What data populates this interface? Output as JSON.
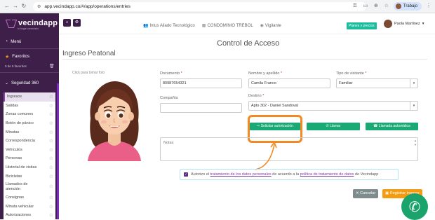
{
  "browser": {
    "url": "app.vecindapp.co/#/app/operations/entries",
    "profile": "Trabajo"
  },
  "sidebar": {
    "logo": "vecindapp",
    "logo_tagline": "tu hogar conectado",
    "menu_label": "Menú",
    "favorites_label": "Favoritos",
    "favorites_count": "0 de 5 favoritos",
    "section": "Seguridad 360",
    "items": [
      {
        "label": "Ingresos"
      },
      {
        "label": "Salidas"
      },
      {
        "label": "Zonas comunes"
      },
      {
        "label": "Botón de pánico"
      },
      {
        "label": "Minutas"
      },
      {
        "label": "Correspondencia"
      },
      {
        "label": "Vehículos"
      },
      {
        "label": "Personas"
      },
      {
        "label": "Historial de visitas"
      },
      {
        "label": "Bicicletas"
      },
      {
        "label": "Llamados de atención"
      },
      {
        "label": "Consignas"
      },
      {
        "label": "Minuta vehicular"
      },
      {
        "label": "Autorizaciones"
      }
    ]
  },
  "topbar": {
    "nav": [
      {
        "label": "Intus Aliado Tecnológico"
      },
      {
        "label": "CONDOMINIO TREBOL"
      },
      {
        "label": "Vigilante"
      }
    ],
    "plans_button": "Planes y precios",
    "user_name": "Paola Martinez"
  },
  "page": {
    "title": "Control de Acceso",
    "section_title": "Ingreso Peatonal",
    "photo_caption": "Click para tomar foto"
  },
  "form": {
    "documento_label": "Documento ",
    "documento_value": "80987654321",
    "nombre_label": "Nombre y apellido ",
    "nombre_value": "Camila Franco",
    "tipo_label": "Tipo de visitante ",
    "tipo_value": "Familiar",
    "compania_label": "Compañía",
    "compania_value": "",
    "destino_label": "Destino ",
    "destino_value": "Apto 302 - Daniel Sandoval",
    "required_mark": "*",
    "solicitar_button": "Solicitar autorización",
    "llamar_button": "Llamar",
    "llamada_auto_button": "Llamada automática",
    "notas_placeholder": "Notas"
  },
  "consent": {
    "prefix": "Autorizo el ",
    "link1": "tratamiento de los datos personales",
    "middle": " de acuerdo a la ",
    "link2": "política de tratamiento de datos",
    "suffix": " de Vecindapp"
  },
  "actions": {
    "cancel": "Cancelar",
    "save": "Registrar ingreso"
  },
  "colors": {
    "sidebar_bg": "#3d1f4a",
    "accent_green": "#19a974",
    "highlight_orange": "#f08a24",
    "save_orange": "#f39c12"
  }
}
